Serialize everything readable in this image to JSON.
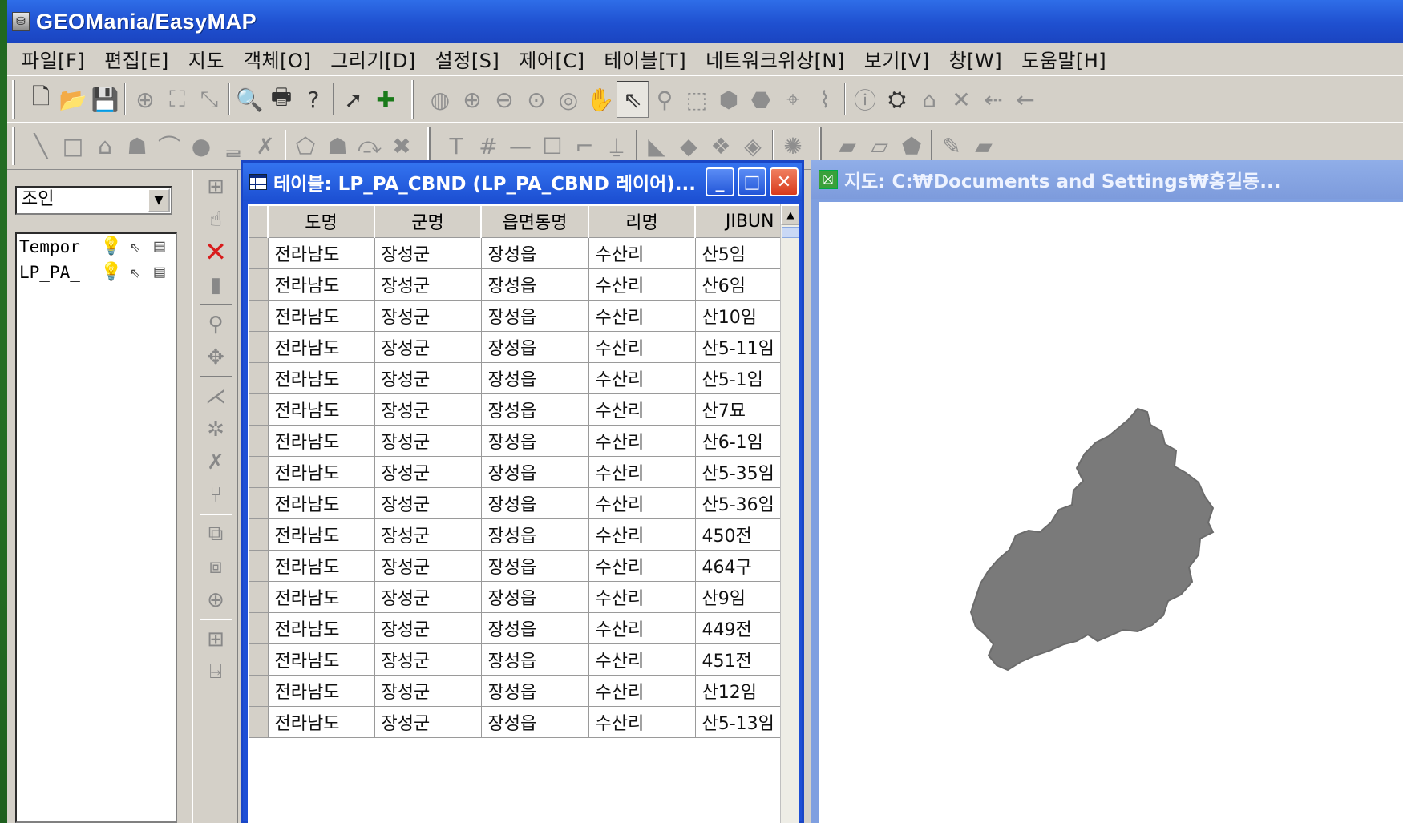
{
  "app": {
    "title": "GEOMania/EasyMAP"
  },
  "menu": [
    "파일[F]",
    "편집[E]",
    "지도",
    "객체[O]",
    "그리기[D]",
    "설정[S]",
    "제어[C]",
    "테이블[T]",
    "네트워크위상[N]",
    "보기[V]",
    "창[W]",
    "도움말[H]"
  ],
  "toolbar1": {
    "icons": [
      "new-file-icon",
      "open-folder-icon",
      "save-icon",
      "zoom-extent-icon",
      "full-extent-icon",
      "shrink-icon",
      "print-preview-icon",
      "print-icon",
      "help-icon",
      "select-arrow-icon",
      "add-cross-icon",
      "globe-icon",
      "zoom-in-icon",
      "zoom-out-icon",
      "zoom-window-icon",
      "zoom-previous-icon",
      "pan-hand-icon",
      "pointer-icon",
      "identify-icon",
      "select-feature-icon",
      "select-area-icon",
      "select-polygon-icon",
      "select-point-icon",
      "select-line-icon",
      "info-icon",
      "find-binoculars-icon",
      "home-icon",
      "clear-icon",
      "back-icon",
      "forward-icon"
    ]
  },
  "toolbar2": {
    "icons": [
      "draw-line-icon",
      "draw-rectangle-icon",
      "draw-polygon-icon",
      "draw-filled-polygon-icon",
      "draw-arc-icon",
      "draw-circle-icon",
      "draw-text-icon",
      "draw-symbol-icon",
      "edit-vertex-icon",
      "move-object-icon",
      "rotate-object-icon",
      "delete-object-icon",
      "text-tool-icon",
      "grid-tool-icon",
      "line-tool-icon",
      "box-tool-icon",
      "corner-tool-icon",
      "label-tool-icon",
      "layer-tool-1-icon",
      "layer-tool-2-icon",
      "layer-tool-3-icon",
      "layer-tool-4-icon",
      "symbol-tool-icon",
      "fill-tool-1-icon",
      "fill-tool-2-icon",
      "fill-tool-3-icon",
      "fill-tool-4-icon",
      "fill-tool-5-icon"
    ]
  },
  "layer_panel": {
    "combo_value": "조인",
    "layers": [
      {
        "name": "Tempor"
      },
      {
        "name": "LP_PA_"
      }
    ]
  },
  "table_window": {
    "title": "테이블: LP_PA_CBND (LP_PA_CBND 레이어)...",
    "columns": [
      "도명",
      "군명",
      "읍면동명",
      "리명",
      "JIBUN"
    ],
    "rows": [
      [
        "전라남도",
        "장성군",
        "장성읍",
        "수산리",
        "산5임"
      ],
      [
        "전라남도",
        "장성군",
        "장성읍",
        "수산리",
        "산6임"
      ],
      [
        "전라남도",
        "장성군",
        "장성읍",
        "수산리",
        "산10임"
      ],
      [
        "전라남도",
        "장성군",
        "장성읍",
        "수산리",
        "산5-11임"
      ],
      [
        "전라남도",
        "장성군",
        "장성읍",
        "수산리",
        "산5-1임"
      ],
      [
        "전라남도",
        "장성군",
        "장성읍",
        "수산리",
        "산7묘"
      ],
      [
        "전라남도",
        "장성군",
        "장성읍",
        "수산리",
        "산6-1임"
      ],
      [
        "전라남도",
        "장성군",
        "장성읍",
        "수산리",
        "산5-35임"
      ],
      [
        "전라남도",
        "장성군",
        "장성읍",
        "수산리",
        "산5-36임"
      ],
      [
        "전라남도",
        "장성군",
        "장성읍",
        "수산리",
        "450전"
      ],
      [
        "전라남도",
        "장성군",
        "장성읍",
        "수산리",
        "464구"
      ],
      [
        "전라남도",
        "장성군",
        "장성읍",
        "수산리",
        "산9임"
      ],
      [
        "전라남도",
        "장성군",
        "장성읍",
        "수산리",
        "449전"
      ],
      [
        "전라남도",
        "장성군",
        "장성읍",
        "수산리",
        "451전"
      ],
      [
        "전라남도",
        "장성군",
        "장성읍",
        "수산리",
        "산12임"
      ],
      [
        "전라남도",
        "장성군",
        "장성읍",
        "수산리",
        "산5-13임"
      ]
    ]
  },
  "map_window": {
    "title": "지도: C:₩Documents and Settings₩홍길동...",
    "region_color": "#7a7a7a"
  },
  "colors": {
    "titlebar": "#1f50d0",
    "chrome": "#d4d0c8",
    "close_red": "#d83a1c"
  }
}
